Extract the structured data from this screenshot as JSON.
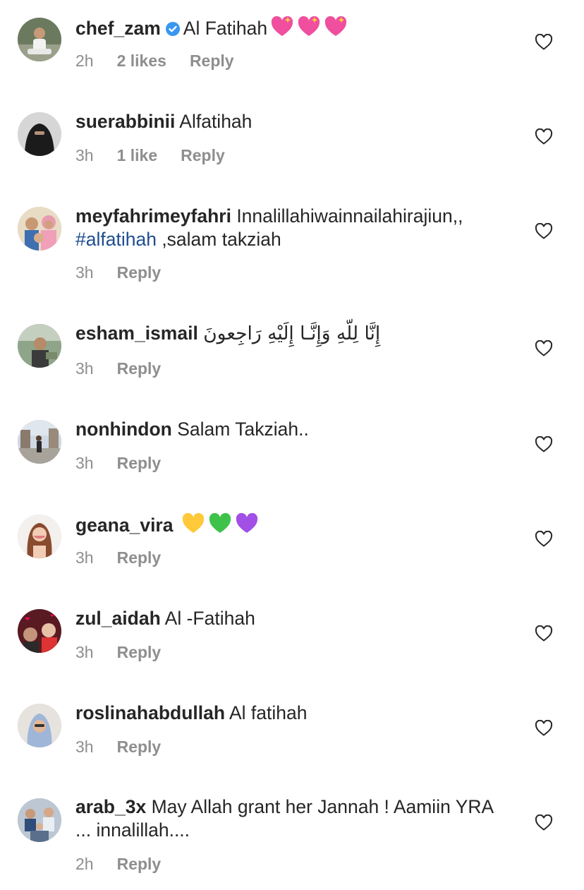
{
  "colors": {
    "text": "#262626",
    "meta": "#8e8e8e",
    "hashtag": "#1f4d8f",
    "verified": "#3897f0"
  },
  "comments": [
    {
      "username": "chef_zam",
      "verified": true,
      "text": "Al Fatihah",
      "emojis": [
        "sparkling-heart",
        "sparkling-heart",
        "sparkling-heart"
      ],
      "time": "2h",
      "likes": "2 likes",
      "reply": "Reply"
    },
    {
      "username": "suerabbinii",
      "text": "Alfatihah",
      "time": "3h",
      "likes": "1 like",
      "reply": "Reply"
    },
    {
      "username": "meyfahrimeyfahri",
      "text": "Innalillahiwainnailahirajiun,,",
      "hashtag": "#alfatihah",
      "text2": ",salam takziah",
      "time": "3h",
      "reply": "Reply"
    },
    {
      "username": "esham_ismail",
      "text": "إِنَّا لِلّهِ وَإِنَّـا إِلَيْهِ رَاجِعونَ",
      "time": "3h",
      "reply": "Reply"
    },
    {
      "username": "nonhindon",
      "text": "Salam Takziah..",
      "time": "3h",
      "reply": "Reply"
    },
    {
      "username": "geana_vira",
      "text": "",
      "emojis": [
        "yellow-heart",
        "green-heart",
        "purple-heart"
      ],
      "time": "3h",
      "reply": "Reply"
    },
    {
      "username": "zul_aidah",
      "text": "Al -Fatihah",
      "time": "3h",
      "reply": "Reply"
    },
    {
      "username": "roslinahabdullah",
      "text": "Al fatihah",
      "time": "3h",
      "reply": "Reply"
    },
    {
      "username": "arab_3x",
      "text": "May Allah grant her Jannah ! Aamiin YRA ... innalillah....",
      "time": "2h",
      "reply": "Reply"
    }
  ]
}
